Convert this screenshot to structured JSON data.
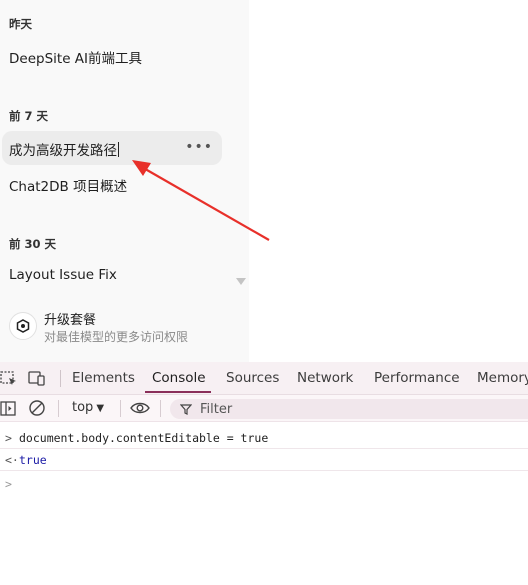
{
  "sidebar": {
    "groups": [
      {
        "label": "昨天",
        "items": [
          "DeepSite AI前端工具"
        ]
      },
      {
        "label": "前 7 天",
        "items": [
          "成为高级开发路径",
          "Chat2DB 项目概述"
        ]
      },
      {
        "label": "前 30 天",
        "items": [
          "Layout Issue Fix"
        ]
      }
    ],
    "more_icon": "more-horizontal-icon",
    "upgrade": {
      "title": "升级套餐",
      "subtitle": "对最佳模型的更多访问权限",
      "icon": "upgrade-hex-icon"
    }
  },
  "annotation": {
    "color": "#e8302a"
  },
  "devtools": {
    "tabs": [
      "Elements",
      "Console",
      "Sources",
      "Network",
      "Performance",
      "Memory"
    ],
    "active_tab": "Console",
    "toolbar": {
      "context": "top",
      "filter_placeholder": "Filter"
    },
    "console": [
      {
        "type": "input",
        "prompt": ">",
        "text": "document.body.contentEditable = true"
      },
      {
        "type": "result",
        "prompt": "<·",
        "text": "true"
      },
      {
        "type": "prompt",
        "prompt": ">",
        "text": ""
      }
    ],
    "accent": "#8a2f5a"
  }
}
